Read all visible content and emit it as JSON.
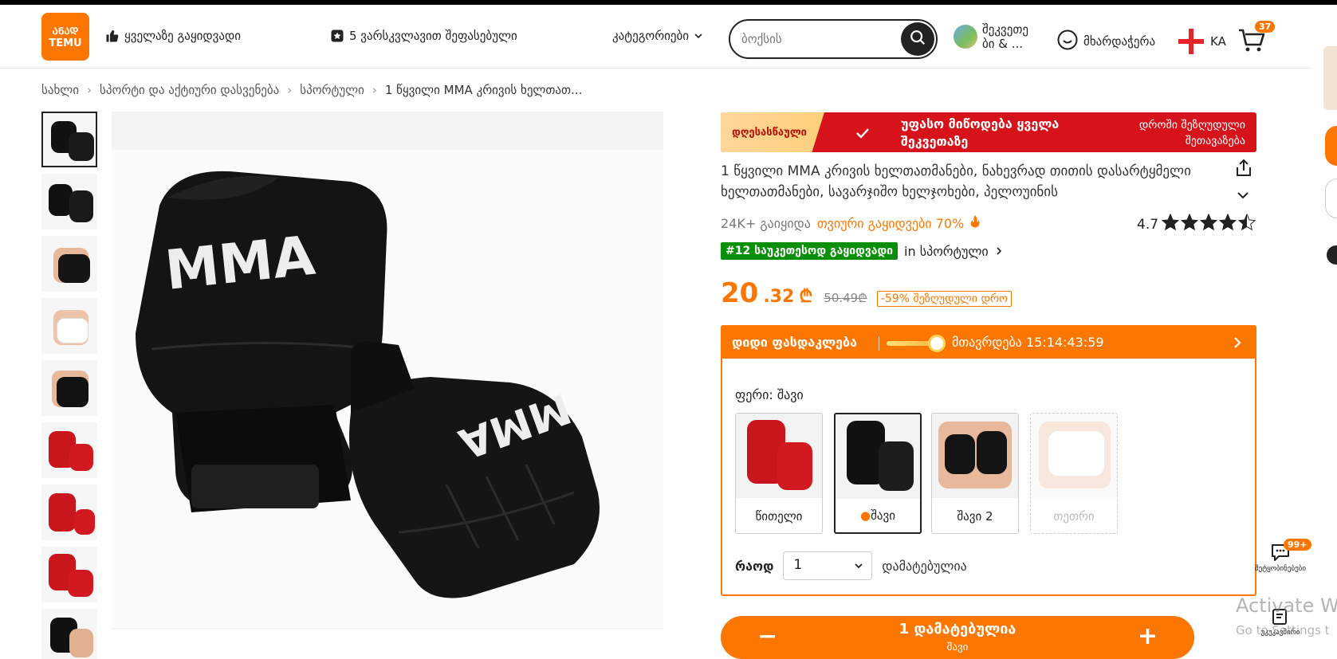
{
  "header": {
    "logo_top": "ᲐᲜᲐᲓ",
    "logo_bottom": "TEMU",
    "best_sellers": "ყველაზე გაყიდვადი",
    "five_star": "5 ვარსკვლავით შეფასებული",
    "categories": "კატეგორიები",
    "search_placeholder": "ბოქსის",
    "orders_line1": "შეკვეთე",
    "orders_line2": "ბი & ...",
    "support": "მხარდაჭერა",
    "language": "KA",
    "cart_count": "37"
  },
  "breadcrumb": [
    "სახლი",
    "სპორტი და აქტიური დასვენება",
    "სპორტული",
    "1 წყვილი MMA კრივის ხელთათ..."
  ],
  "promo": {
    "tag": "დღესასწაული",
    "text": "უფასო მიწოდება ყველა შეკვეთაზე",
    "right": "დროში შეზღუდული შეთავაზება"
  },
  "product": {
    "title": "1 წყვილი MMA კრივის ხელთათმანები, ნახევრად თითის დასარტყმელი ხელთათმანები, სავარჯიშო ხელჯოხები, პელოუინის",
    "sold": "24K+ გაიყიდა",
    "hot": "თვიური გაყიდვები 70%",
    "rating": "4.7",
    "rating_stars": 4.5,
    "rank_badge": "#12 საუკეთესოდ გაყიდვადი",
    "rank_cat": "in სპორტული",
    "price_int": "20",
    "price_dec": ".32",
    "currency": "₾",
    "old_price": "50.49₾",
    "discount": "-59% შეზღუდული დრო"
  },
  "sale": {
    "label": "დიდი ფასდაკლება",
    "ends": "მთავრდება 15:14:43:59"
  },
  "colors": {
    "label": "ფერი: შავი",
    "options": [
      "წითელი",
      "შავი",
      "შავი 2",
      "თეთრი"
    ]
  },
  "quantity": {
    "label": "რაოდ",
    "value": "1",
    "note": "დამატებულია"
  },
  "add_button": {
    "minus": "−",
    "plus": "+",
    "text": "1 დამატებულია",
    "sub": "შავი"
  },
  "floating": {
    "chat_badge": "99+",
    "chat_label": "შეტყობინებები",
    "notes_label": "უკუკავშირი"
  },
  "watermark": {
    "line1": "Activate Wi",
    "line2": "Go to Settings t"
  },
  "colors_hex": {
    "accent": "#fb7701",
    "promo_red": "#d6121b",
    "rank_green": "#0a8f08"
  }
}
